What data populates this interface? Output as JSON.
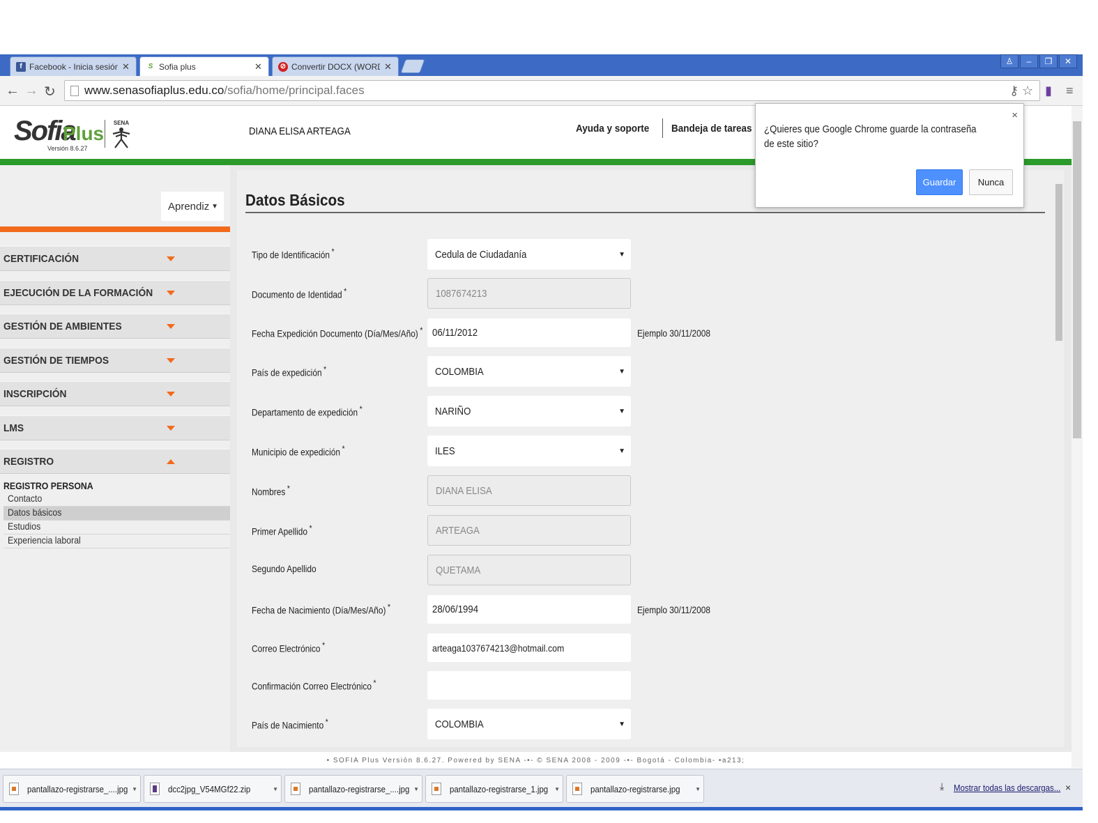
{
  "browser": {
    "tabs": [
      {
        "label": "Facebook - Inicia sesión o re",
        "favicon": "f",
        "color": "#3b5998"
      },
      {
        "label": "Sofia plus",
        "favicon": "S",
        "color": "#5fa03a"
      },
      {
        "label": "Convertir DOCX (WORD) a J",
        "favicon": "⊘",
        "color": "#d42020"
      }
    ],
    "url_host": "www.senasofiaplus.edu.co",
    "url_path": "/sofia/home/principal.faces"
  },
  "header": {
    "logo_text": "Sofia",
    "logo_plus": "Plus",
    "logo_version": "Versión 8.6.27",
    "sena_label": "SENA",
    "user_name": "DIANA ELISA ARTEAGA",
    "help_link": "Ayuda y soporte",
    "inbox_link": "Bandeja de tareas"
  },
  "sidebar": {
    "role": "Aprendiz",
    "menu": [
      {
        "label": "CERTIFICACIÓN",
        "expanded": false
      },
      {
        "label": "EJECUCIÓN DE LA FORMACIÓN",
        "expanded": false
      },
      {
        "label": "GESTIÓN DE AMBIENTES",
        "expanded": false
      },
      {
        "label": "GESTIÓN DE TIEMPOS",
        "expanded": false
      },
      {
        "label": "INSCRIPCIÓN",
        "expanded": false
      },
      {
        "label": "LMS",
        "expanded": false
      },
      {
        "label": "REGISTRO",
        "expanded": true
      }
    ],
    "submenu_title": "REGISTRO PERSONA",
    "submenu": [
      "Contacto",
      "Datos básicos",
      "Estudios",
      "Experiencia laboral"
    ],
    "selected_submenu": "Datos básicos"
  },
  "form": {
    "title": "Datos Básicos",
    "required_mark": "*",
    "hint_text": "Ejemplo 30/11/2008",
    "fields": [
      {
        "label": "Tipo de Identificación",
        "value": "Cedula de Ciudadanía",
        "kind": "select",
        "required": true
      },
      {
        "label": "Documento de Identidad",
        "value": "1087674213",
        "kind": "disabled",
        "required": true
      },
      {
        "label": "Fecha Expedición Documento (Día/Mes/Año)",
        "value": "06/11/2012",
        "kind": "text",
        "required": true,
        "hint": true
      },
      {
        "label": "País de expedición",
        "value": "COLOMBIA",
        "kind": "select",
        "required": true
      },
      {
        "label": "Departamento de expedición",
        "value": "NARIÑO",
        "kind": "select",
        "required": true
      },
      {
        "label": "Municipio de expedición",
        "value": "ILES",
        "kind": "select",
        "required": true
      },
      {
        "label": "Nombres",
        "value": "DIANA ELISA",
        "kind": "disabled",
        "required": true
      },
      {
        "label": "Primer Apellido",
        "value": "ARTEAGA",
        "kind": "disabled",
        "required": true
      },
      {
        "label": "Segundo Apellido",
        "value": "QUETAMA",
        "kind": "disabled",
        "required": false
      },
      {
        "label": "Fecha de Nacimiento (Día/Mes/Año)",
        "value": "28/06/1994",
        "kind": "text",
        "required": true,
        "hint": true
      },
      {
        "label": "Correo Electrónico",
        "value": "arteaga1037674213@hotmail.com",
        "kind": "text",
        "required": true
      },
      {
        "label": "Confirmación Correo Electrónico",
        "value": "",
        "kind": "text",
        "required": true
      },
      {
        "label": "País de Nacimiento",
        "value": "COLOMBIA",
        "kind": "select",
        "required": true
      }
    ]
  },
  "password_prompt": {
    "text": "¿Quieres que Google Chrome guarde la contraseña de este sitio?",
    "save_label": "Guardar",
    "never_label": "Nunca",
    "close_label": "×"
  },
  "footer": {
    "text": "• SOFIA Plus Versión 8.6.27. Powered by SENA -•- © SENA 2008 - 2009 -•- Bogotá - Colombia- •a213;"
  },
  "downloads": {
    "items": [
      {
        "name": "pantallazo-registrarse_....jpg",
        "icon": "image-file-icon"
      },
      {
        "name": "dcc2jpg_V54MGf22.zip",
        "icon": "zip-file-icon"
      },
      {
        "name": "pantallazo-registrarse_....jpg",
        "icon": "image-file-icon"
      },
      {
        "name": "pantallazo-registrarse_1.jpg",
        "icon": "image-file-icon"
      },
      {
        "name": "pantallazo-registrarse.jpg",
        "icon": "image-file-icon"
      }
    ],
    "show_all_label": "Mostrar todas las descargas...",
    "close_label": "×"
  }
}
